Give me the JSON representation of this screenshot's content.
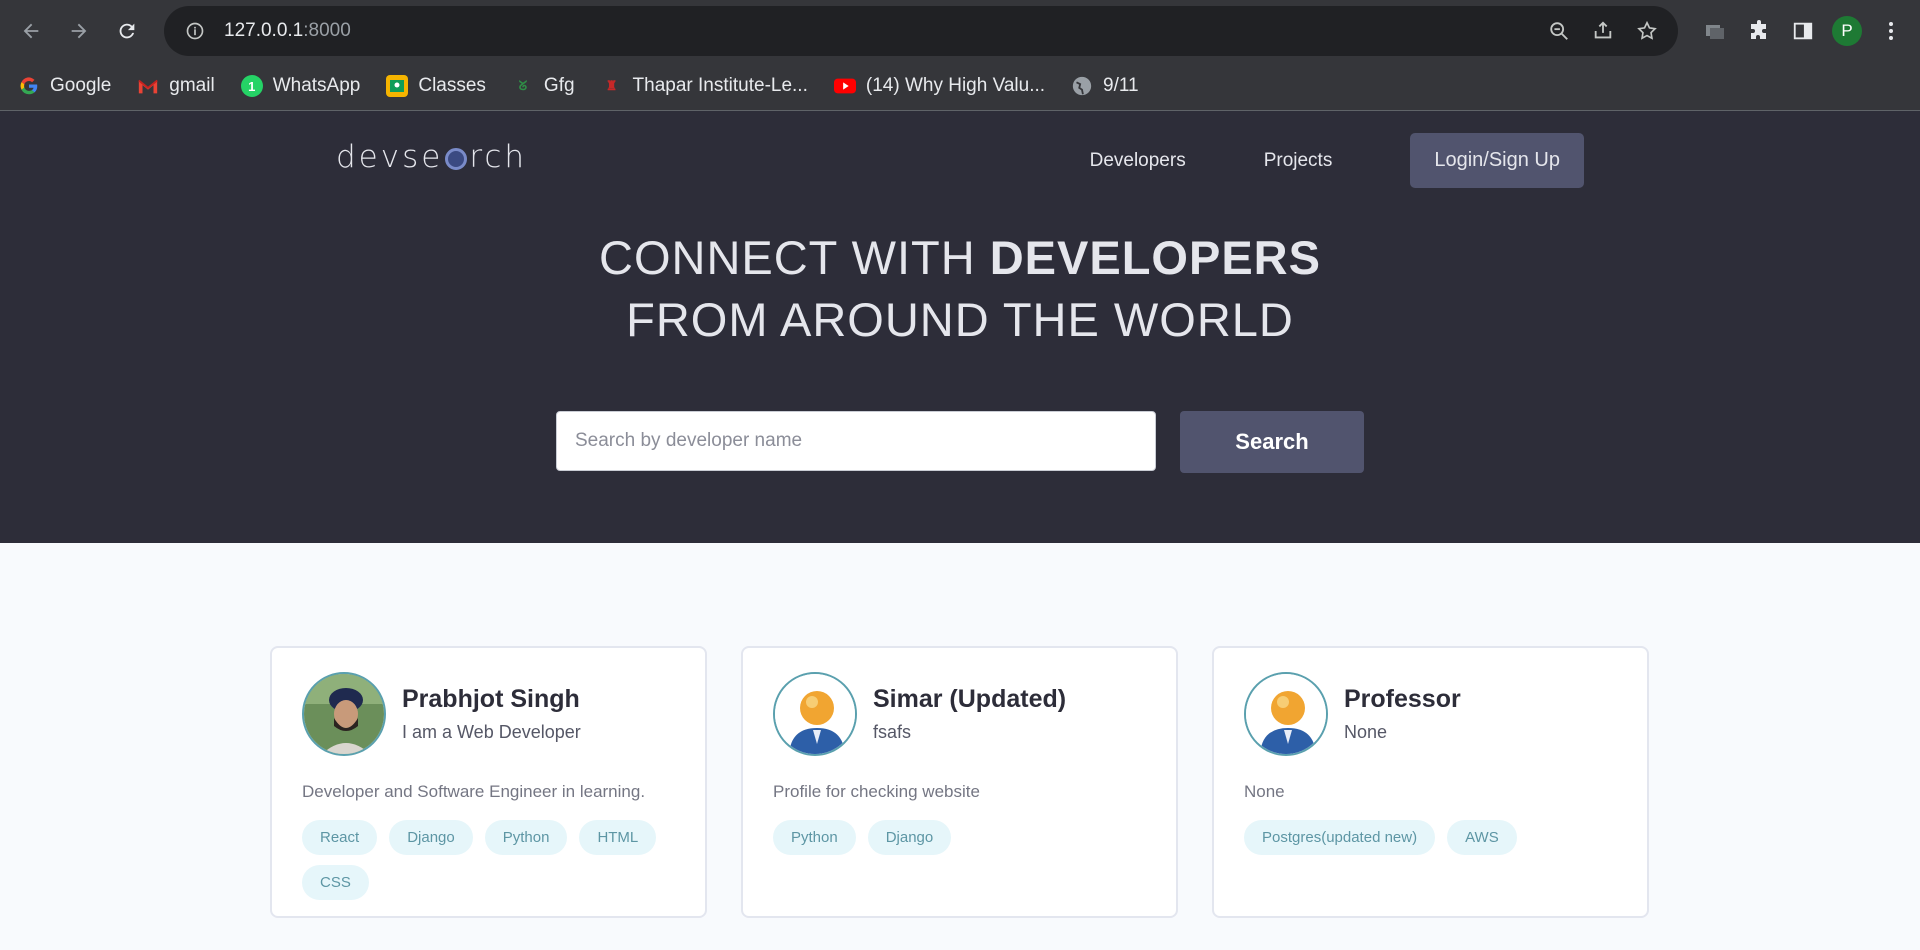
{
  "browser": {
    "url_host": "127.0.0.1",
    "url_port": ":8000",
    "profile_initial": "P",
    "bookmarks": [
      {
        "label": "Google",
        "icon": "google-icon"
      },
      {
        "label": "gmail",
        "icon": "gmail-icon"
      },
      {
        "label": "WhatsApp",
        "icon": "whatsapp-icon"
      },
      {
        "label": "Classes",
        "icon": "classroom-icon"
      },
      {
        "label": "Gfg",
        "icon": "gfg-icon"
      },
      {
        "label": "Thapar Institute-Le...",
        "icon": "thapar-icon"
      },
      {
        "label": "(14) Why High Valu...",
        "icon": "youtube-icon"
      },
      {
        "label": "9/11",
        "icon": "globe-icon"
      }
    ]
  },
  "site": {
    "logo_left": "devse",
    "logo_right": "rch",
    "nav": {
      "developers": "Developers",
      "projects": "Projects",
      "login": "Login/Sign Up"
    },
    "hero": {
      "line1_light": "CONNECT WITH ",
      "line1_bold": "DEVELOPERS",
      "line2": "FROM AROUND THE WORLD"
    },
    "search": {
      "placeholder": "Search by developer name",
      "button": "Search"
    }
  },
  "developers": [
    {
      "name": "Prabhjot Singh",
      "headline": "I am a Web Developer",
      "bio": "Developer and Software Engineer in learning.",
      "tags": [
        "React",
        "Django",
        "Python",
        "HTML",
        "CSS"
      ],
      "avatar": "photo"
    },
    {
      "name": "Simar (Updated)",
      "headline": "fsafs",
      "bio": "Profile for checking website",
      "tags": [
        "Python",
        "Django"
      ],
      "avatar": "default-user"
    },
    {
      "name": "Professor",
      "headline": "None",
      "bio": "None",
      "tags": [
        "Postgres(updated new)",
        "AWS"
      ],
      "avatar": "default-user"
    }
  ]
}
